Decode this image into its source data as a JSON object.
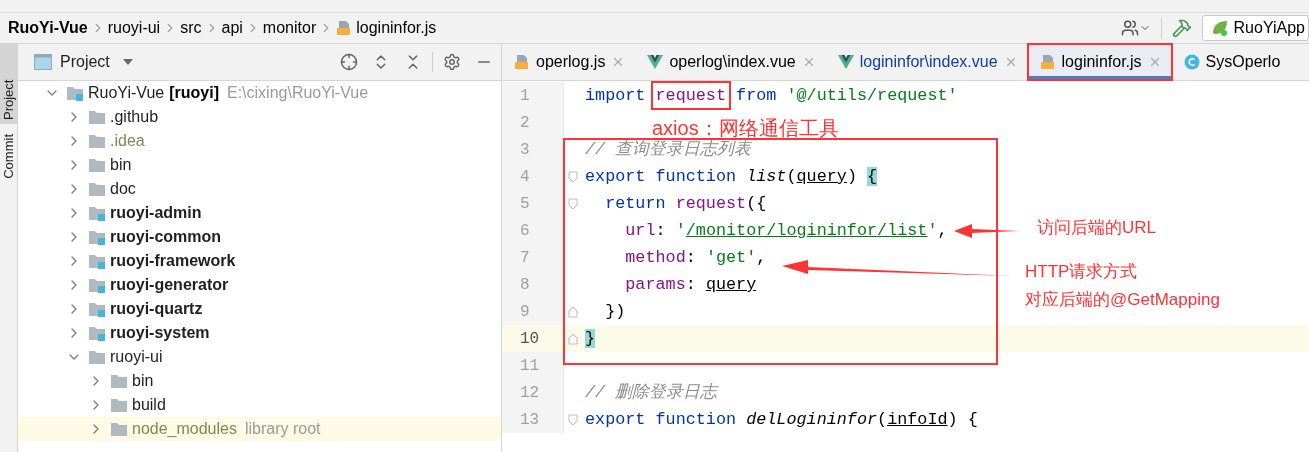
{
  "breadcrumb": [
    {
      "text": "RuoYi-Vue",
      "bold": true,
      "kind": "text"
    },
    {
      "text": "ruoyi-ui",
      "bold": false,
      "kind": "text"
    },
    {
      "text": "src",
      "bold": false,
      "kind": "text"
    },
    {
      "text": "api",
      "bold": false,
      "kind": "text"
    },
    {
      "text": "monitor",
      "bold": false,
      "kind": "text"
    },
    {
      "text": "logininfor.js",
      "bold": false,
      "kind": "js"
    }
  ],
  "toolbar": {
    "run_config": "RuoYiApp"
  },
  "side_strip": [
    {
      "label": "Project",
      "selected": true
    },
    {
      "label": "Commit",
      "selected": false
    }
  ],
  "project_panel": {
    "title": "Project",
    "tree": [
      {
        "name": "RuoYi-Vue",
        "suffix": "[ruoyi]",
        "hint": "E:\\cixing\\RuoYi-Vue",
        "kind": "module",
        "bold": false,
        "dim": false,
        "expanded": true,
        "highlighted": false,
        "children": [
          {
            "name": ".github",
            "kind": "folder",
            "bold": false,
            "dim": false,
            "expanded": false,
            "highlighted": false
          },
          {
            "name": ".idea",
            "kind": "folder",
            "bold": false,
            "dim": true,
            "expanded": false,
            "highlighted": false
          },
          {
            "name": "bin",
            "kind": "folder",
            "bold": false,
            "dim": false,
            "expanded": false,
            "highlighted": false
          },
          {
            "name": "doc",
            "kind": "folder",
            "bold": false,
            "dim": false,
            "expanded": false,
            "highlighted": false
          },
          {
            "name": "ruoyi-admin",
            "kind": "module",
            "bold": true,
            "dim": false,
            "expanded": false,
            "highlighted": false
          },
          {
            "name": "ruoyi-common",
            "kind": "module",
            "bold": true,
            "dim": false,
            "expanded": false,
            "highlighted": false
          },
          {
            "name": "ruoyi-framework",
            "kind": "module",
            "bold": true,
            "dim": false,
            "expanded": false,
            "highlighted": false
          },
          {
            "name": "ruoyi-generator",
            "kind": "module",
            "bold": true,
            "dim": false,
            "expanded": false,
            "highlighted": false
          },
          {
            "name": "ruoyi-quartz",
            "kind": "module",
            "bold": true,
            "dim": false,
            "expanded": false,
            "highlighted": false
          },
          {
            "name": "ruoyi-system",
            "kind": "module",
            "bold": true,
            "dim": false,
            "expanded": false,
            "highlighted": false
          },
          {
            "name": "ruoyi-ui",
            "kind": "folder",
            "bold": false,
            "dim": false,
            "expanded": true,
            "highlighted": false,
            "children": [
              {
                "name": "bin",
                "kind": "folder",
                "bold": false,
                "dim": false,
                "expanded": false,
                "highlighted": false
              },
              {
                "name": "build",
                "kind": "folder",
                "bold": false,
                "dim": false,
                "expanded": false,
                "highlighted": false
              },
              {
                "name": "node_modules",
                "hint": "library root",
                "kind": "folder",
                "bold": false,
                "dim": true,
                "expanded": false,
                "highlighted": true
              }
            ]
          }
        ]
      }
    ]
  },
  "tabs": [
    {
      "label": "operlog.js",
      "kind": "js",
      "selected": false,
      "modified": false,
      "closable": true,
      "annotated": false
    },
    {
      "label": "operlog\\index.vue",
      "kind": "vue",
      "selected": false,
      "modified": false,
      "closable": true,
      "annotated": false
    },
    {
      "label": "logininfor\\index.vue",
      "kind": "vue",
      "selected": false,
      "modified": true,
      "closable": true,
      "annotated": false
    },
    {
      "label": "logininfor.js",
      "kind": "js",
      "selected": true,
      "modified": false,
      "closable": true,
      "annotated": true
    },
    {
      "label": "SysOperlo",
      "kind": "class",
      "selected": false,
      "modified": false,
      "closable": false,
      "annotated": false
    }
  ],
  "code_lines": [
    {
      "number": "1",
      "current": false,
      "fold_start": false,
      "fold_end": false,
      "tokens": [
        {
          "kind": "keyword",
          "text": "import "
        },
        {
          "kind": "ident",
          "text": "request",
          "annotated": true
        },
        {
          "kind": "keyword",
          "text": " from "
        },
        {
          "kind": "string",
          "text": "'@/utils/request'"
        }
      ]
    },
    {
      "number": "2",
      "current": false,
      "fold_start": false,
      "fold_end": false
    },
    {
      "number": "3",
      "current": false,
      "fold_start": false,
      "fold_end": false,
      "tokens": [
        {
          "kind": "comment",
          "text": "// 查询登录日志列表"
        }
      ]
    },
    {
      "number": "4",
      "current": false,
      "fold_start": true,
      "fold_end": false,
      "tokens": [
        {
          "kind": "keyword",
          "text": "export function "
        },
        {
          "kind": "fn",
          "text": "list"
        },
        {
          "kind": "plain",
          "text": "("
        },
        {
          "kind": "param",
          "text": "query"
        },
        {
          "kind": "plain",
          "text": ") "
        },
        {
          "kind": "brace",
          "text": "{"
        }
      ]
    },
    {
      "number": "5",
      "current": false,
      "fold_start": true,
      "fold_end": false,
      "tokens": [
        {
          "kind": "keyword",
          "text": "  return "
        },
        {
          "kind": "ident",
          "text": "request"
        },
        {
          "kind": "plain",
          "text": "({"
        }
      ]
    },
    {
      "number": "6",
      "current": false,
      "fold_start": false,
      "fold_end": false,
      "tokens": [
        {
          "kind": "prop",
          "text": "    url"
        },
        {
          "kind": "plain",
          "text": ": "
        },
        {
          "kind": "string",
          "text": "'"
        },
        {
          "kind": "path",
          "text": "/monitor/logininfor/list"
        },
        {
          "kind": "string",
          "text": "'"
        },
        {
          "kind": "plain",
          "text": ","
        }
      ]
    },
    {
      "number": "7",
      "current": false,
      "fold_start": false,
      "fold_end": false,
      "tokens": [
        {
          "kind": "prop",
          "text": "    method"
        },
        {
          "kind": "plain",
          "text": ": "
        },
        {
          "kind": "string",
          "text": "'get'"
        },
        {
          "kind": "plain",
          "text": ","
        }
      ]
    },
    {
      "number": "8",
      "current": false,
      "fold_start": false,
      "fold_end": false,
      "tokens": [
        {
          "kind": "prop",
          "text": "    params"
        },
        {
          "kind": "plain",
          "text": ": "
        },
        {
          "kind": "param",
          "text": "query"
        }
      ]
    },
    {
      "number": "9",
      "current": false,
      "fold_start": false,
      "fold_end": true,
      "tokens": [
        {
          "kind": "plain",
          "text": "  })"
        }
      ]
    },
    {
      "number": "10",
      "current": true,
      "fold_start": false,
      "fold_end": true,
      "tokens": [
        {
          "kind": "brace",
          "text": "}"
        }
      ]
    },
    {
      "number": "11",
      "current": false,
      "fold_start": false,
      "fold_end": false
    },
    {
      "number": "12",
      "current": false,
      "fold_start": false,
      "fold_end": false,
      "tokens": [
        {
          "kind": "comment",
          "text": "// 删除登录日志"
        }
      ]
    },
    {
      "number": "13",
      "current": false,
      "fold_start": true,
      "fold_end": false,
      "tokens": [
        {
          "kind": "keyword",
          "text": "export function "
        },
        {
          "kind": "fn",
          "text": "delLogininfor"
        },
        {
          "kind": "plain",
          "text": "("
        },
        {
          "kind": "param",
          "text": "infoId"
        },
        {
          "kind": "plain",
          "text": ") {"
        }
      ]
    }
  ],
  "annotations": [
    {
      "text": "axios：网络通信工具"
    },
    {
      "text": "访问后端的URL"
    },
    {
      "text": "HTTP请求方式"
    },
    {
      "text": "对应后端的@GetMapping"
    }
  ]
}
